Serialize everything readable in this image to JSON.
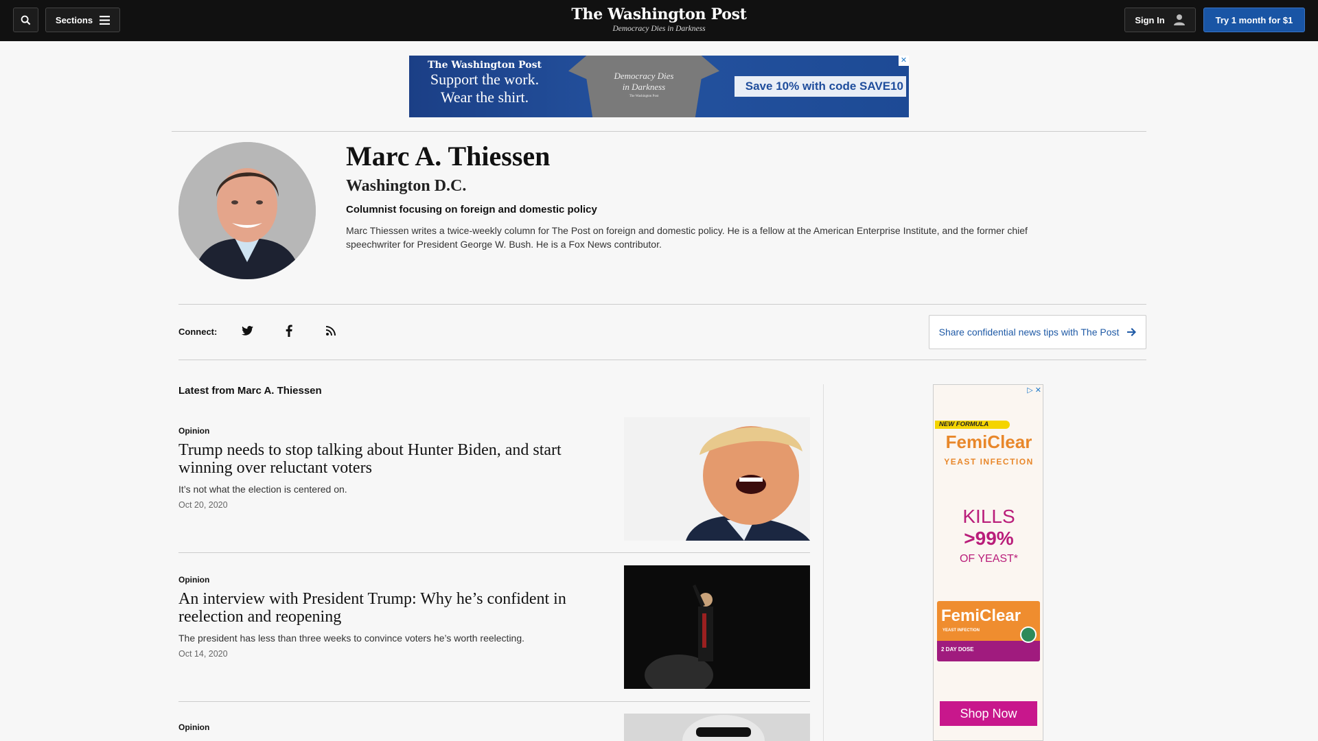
{
  "nav": {
    "sections_label": "Sections",
    "masthead_logo": "The Washington Post",
    "masthead_tagline": "Democracy Dies in Darkness",
    "signin_label": "Sign In",
    "try_label": "Try 1 month for $1"
  },
  "ad_banner": {
    "logo": "The Washington Post",
    "line1": "Support the work.",
    "line2": "Wear the shirt.",
    "shirt_line1": "Democracy Dies",
    "shirt_line2": "in Darkness",
    "shirt_logo": "The Washington Post",
    "promo": "Save 10% with code SAVE10"
  },
  "author": {
    "name": "Marc A. Thiessen",
    "location": "Washington D.C.",
    "role": "Columnist focusing on foreign and domestic policy",
    "bio": "Marc Thiessen writes a twice-weekly column for The Post on foreign and domestic policy. He is a fellow at the American Enterprise Institute, and the former chief speechwriter for President George W. Bush. He is a Fox News contributor."
  },
  "connect": {
    "label": "Connect:",
    "tips_label": "Share confidential news tips with The Post"
  },
  "feed": {
    "heading": "Latest from Marc A. Thiessen",
    "articles": [
      {
        "label": "Opinion",
        "headline": "Trump needs to stop talking about Hunter Biden, and start winning over reluctant voters",
        "blurb": "It’s not what the election is centered on.",
        "date": "Oct 20, 2020"
      },
      {
        "label": "Opinion",
        "headline": "An interview with President Trump: Why he’s confident in reelection and reopening",
        "blurb": "The president has less than three weeks to convince voters he’s worth reelecting.",
        "date": "Oct 14, 2020"
      },
      {
        "label": "Opinion"
      }
    ]
  },
  "side_ad": {
    "tag": "NEW FORMULA",
    "brand": "FemiClear",
    "sub": "YEAST INFECTION",
    "kills1": "KILLS",
    "kills2": ">99%",
    "kills3": "OF YEAST*",
    "box_brand": "FemiClear",
    "box_sub": "YEAST INFECTION",
    "box_dose": "2 DAY DOSE",
    "shop_label": "Shop Now"
  }
}
